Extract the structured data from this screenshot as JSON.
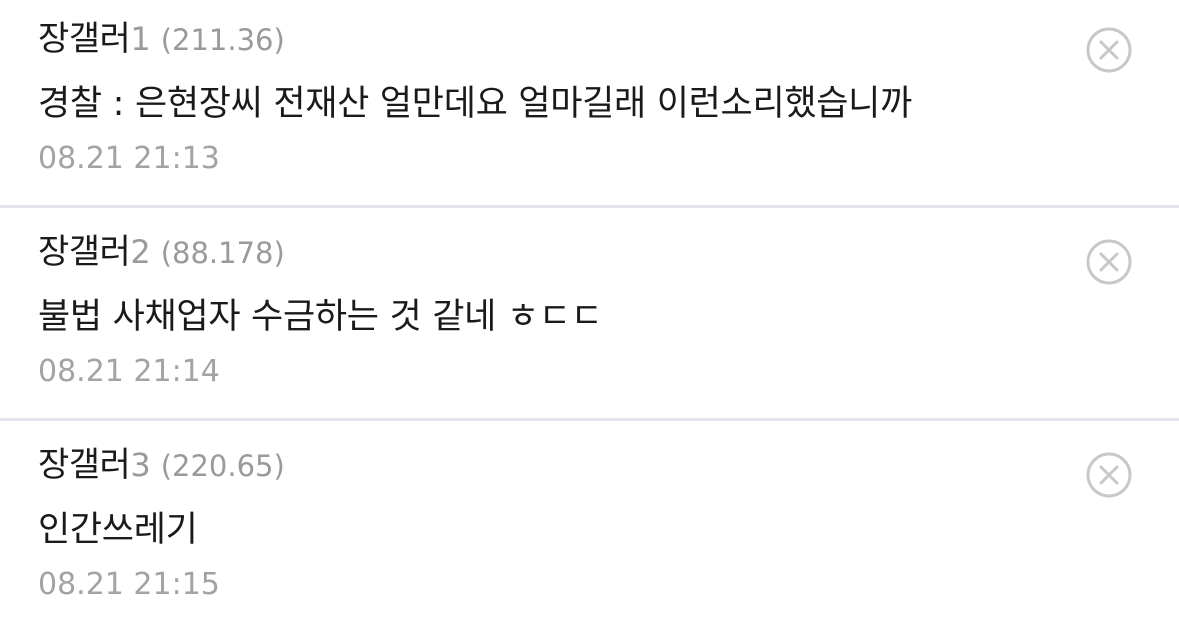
{
  "comments": [
    {
      "nickname": "장갤러",
      "nick_number": "1",
      "ip": "(211.36)",
      "text": "경찰 : 은현장씨 전재산 얼만데요 얼마길래 이런소리했습니까",
      "timestamp": "08.21 21:13",
      "delete_icon": "circle-x-icon"
    },
    {
      "nickname": "장갤러",
      "nick_number": "2",
      "ip": "(88.178)",
      "text": "불법 사채업자 수금하는 것 같네 ㅎㄷㄷ",
      "timestamp": "08.21 21:14",
      "delete_icon": "circle-x-icon"
    },
    {
      "nickname": "장갤러",
      "nick_number": "3",
      "ip": "(220.65)",
      "text": "인간쓰레기",
      "timestamp": "08.21 21:15",
      "delete_icon": "circle-x-icon"
    }
  ],
  "colors": {
    "text_primary": "#1a1a1a",
    "text_secondary": "#9a9a9a",
    "divider": "#e4e4ee",
    "icon": "#c8c8cc"
  }
}
